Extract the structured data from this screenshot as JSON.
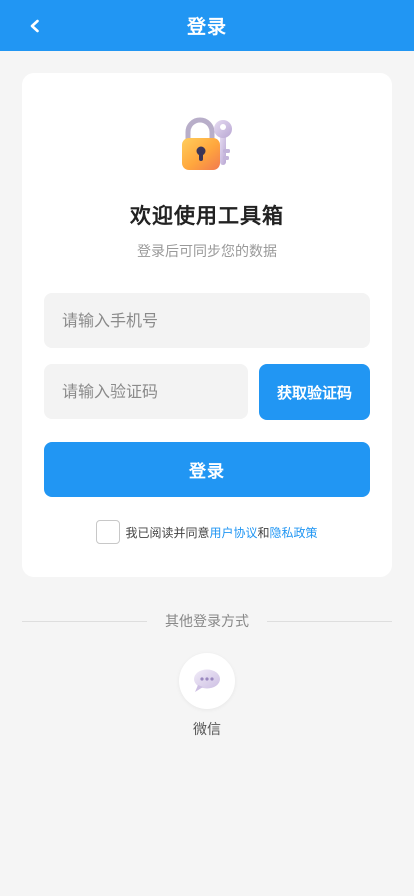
{
  "header": {
    "back_icon": "chevron-left-icon",
    "title": "登录",
    "background": "#2196f3"
  },
  "card": {
    "icon": "lock-with-key-icon",
    "welcome": "欢迎使用工具箱",
    "subtitle": "登录后可同步您的数据",
    "phone_placeholder": "请输入手机号",
    "phone_value": "",
    "code_placeholder": "请输入验证码",
    "code_value": "",
    "get_code_label": "获取验证码",
    "login_label": "登录",
    "agreement": {
      "checked": false,
      "prefix": "我已阅读并同意",
      "user_agreement": "用户协议",
      "and": "和",
      "privacy_policy": "隐私政策"
    }
  },
  "other_login": {
    "title": "其他登录方式",
    "wechat_icon": "speech-bubble-icon",
    "wechat_label": "微信"
  },
  "colors": {
    "accent": "#2196f3",
    "page_background": "#f5f5f5"
  }
}
